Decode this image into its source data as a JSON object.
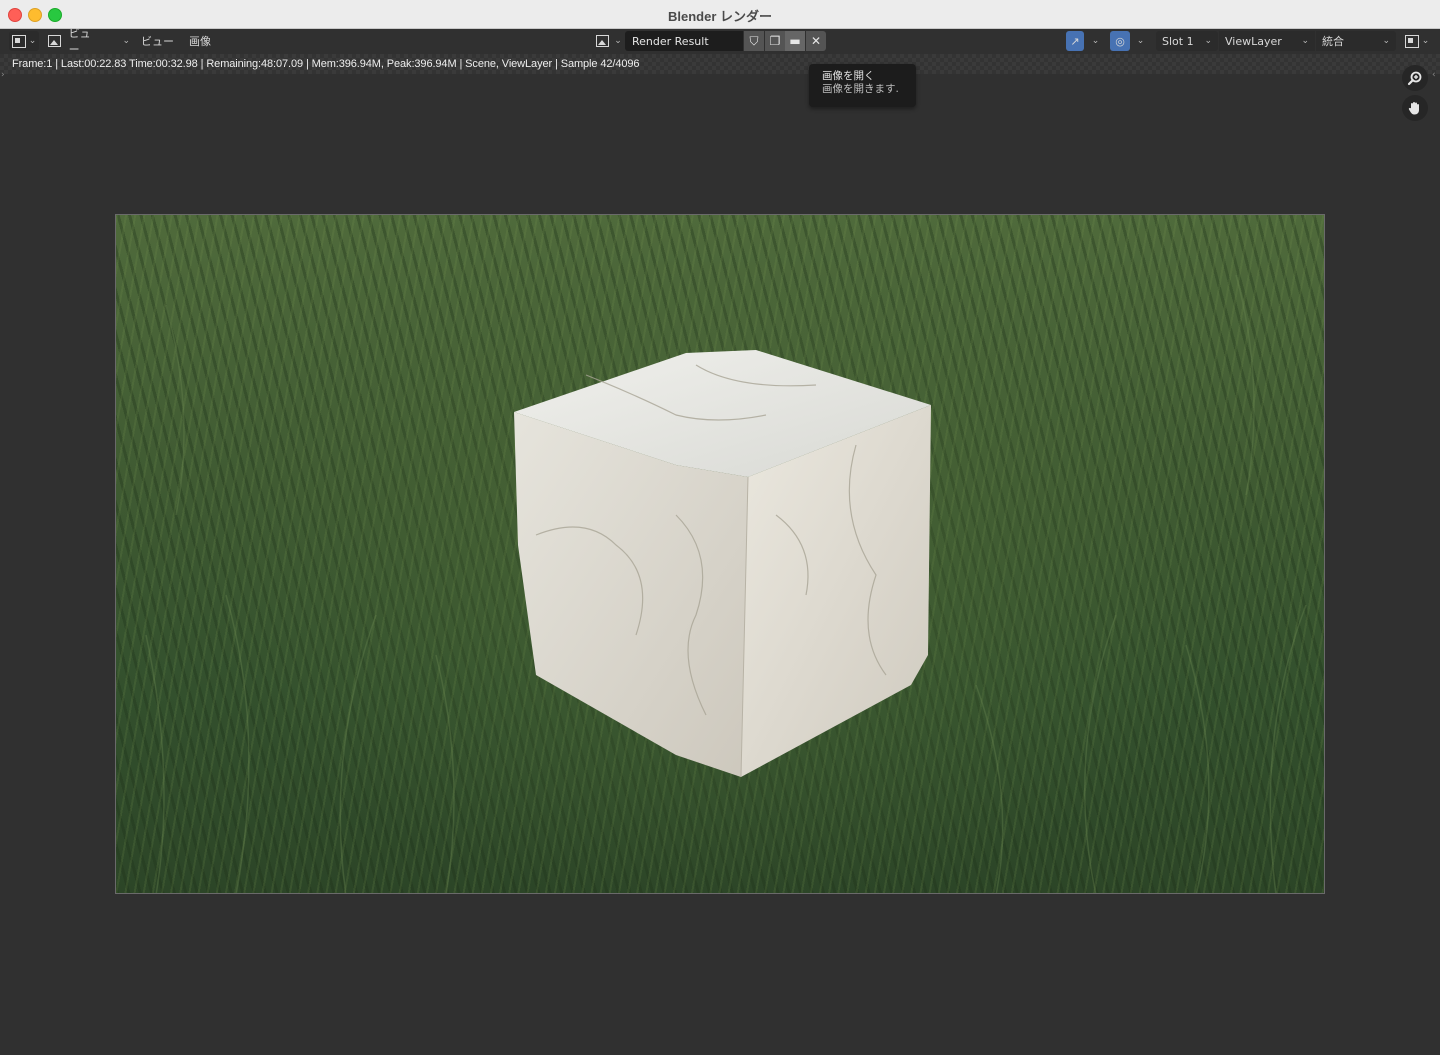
{
  "window": {
    "title": "Blender レンダー"
  },
  "header": {
    "view_mode": "ビュー",
    "menus": [
      "ビュー",
      "画像"
    ],
    "image_name": "Render Result",
    "slot": "Slot 1",
    "view_layer": "ViewLayer",
    "pass": "統合"
  },
  "stats": {
    "text": "Frame:1 | Last:00:22.83 Time:00:32.98 | Remaining:48:07.09 | Mem:396.94M, Peak:396.94M | Scene, ViewLayer | Sample 42/4096"
  },
  "tooltip": {
    "title": "画像を開く",
    "description": "画像を開きます."
  },
  "colors": {
    "accent": "#4772b3",
    "background": "#303030"
  },
  "icons": {
    "editor_type": "image-editor-icon",
    "zoom": "zoom-icon",
    "pan": "hand-icon"
  }
}
